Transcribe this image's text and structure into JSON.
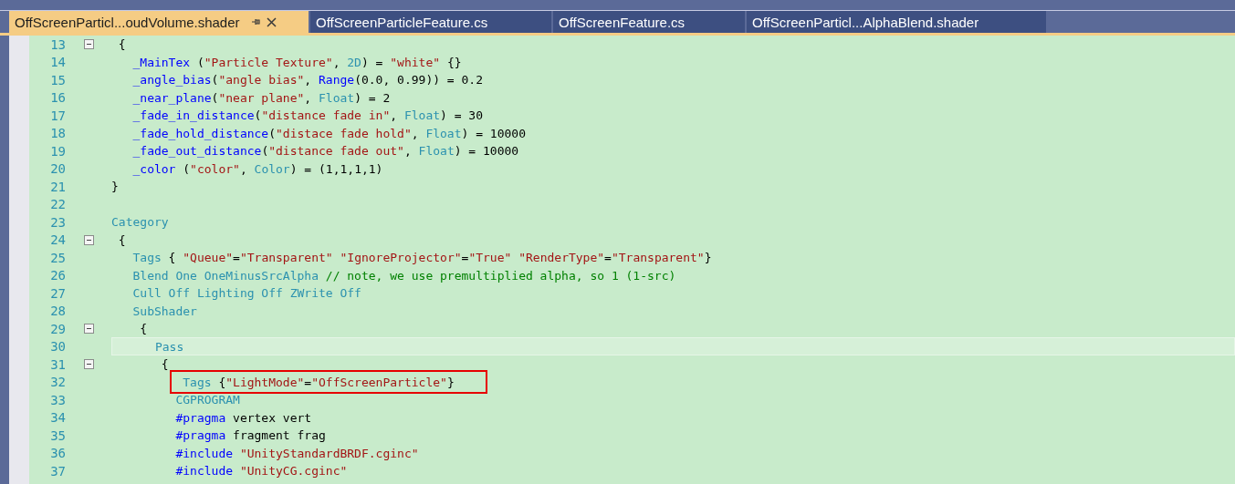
{
  "tabs": [
    {
      "label": "OffScreenParticl...oudVolume.shader",
      "selected": true,
      "pinned": true
    },
    {
      "label": "OffScreenParticleFeature.cs",
      "selected": false,
      "pinned": false
    },
    {
      "label": "OffScreenFeature.cs",
      "selected": false,
      "pinned": false
    },
    {
      "label": "OffScreenParticl...AlphaBlend.shader",
      "selected": false,
      "pinned": false
    }
  ],
  "lines": [
    {
      "number": "13",
      "fold": true,
      "tokens": [
        {
          "t": " {",
          "kind": "plain"
        }
      ]
    },
    {
      "number": "14",
      "tokens": [
        {
          "t": "   _MainTex",
          "kind": "ident"
        },
        {
          "t": " (",
          "kind": "plain"
        },
        {
          "t": "\"Particle Texture\"",
          "kind": "string"
        },
        {
          "t": ", ",
          "kind": "plain"
        },
        {
          "t": "2D",
          "kind": "type"
        },
        {
          "t": ") = ",
          "kind": "plain"
        },
        {
          "t": "\"white\"",
          "kind": "string"
        },
        {
          "t": " {}",
          "kind": "plain"
        }
      ]
    },
    {
      "number": "15",
      "tokens": [
        {
          "t": "   _angle_bias",
          "kind": "ident"
        },
        {
          "t": "(",
          "kind": "plain"
        },
        {
          "t": "\"angle bias\"",
          "kind": "string"
        },
        {
          "t": ", ",
          "kind": "plain"
        },
        {
          "t": "Range",
          "kind": "ident"
        },
        {
          "t": "(0.0, 0.99)) = 0.2",
          "kind": "plain"
        }
      ]
    },
    {
      "number": "16",
      "tokens": [
        {
          "t": "   _near_plane",
          "kind": "ident"
        },
        {
          "t": "(",
          "kind": "plain"
        },
        {
          "t": "\"near plane\"",
          "kind": "string"
        },
        {
          "t": ", ",
          "kind": "plain"
        },
        {
          "t": "Float",
          "kind": "type"
        },
        {
          "t": ") = 2",
          "kind": "plain"
        }
      ]
    },
    {
      "number": "17",
      "tokens": [
        {
          "t": "   _fade_in_distance",
          "kind": "ident"
        },
        {
          "t": "(",
          "kind": "plain"
        },
        {
          "t": "\"distance fade in\"",
          "kind": "string"
        },
        {
          "t": ", ",
          "kind": "plain"
        },
        {
          "t": "Float",
          "kind": "type"
        },
        {
          "t": ") = 30",
          "kind": "plain"
        }
      ]
    },
    {
      "number": "18",
      "tokens": [
        {
          "t": "   _fade_hold_distance",
          "kind": "ident"
        },
        {
          "t": "(",
          "kind": "plain"
        },
        {
          "t": "\"distace fade hold\"",
          "kind": "string"
        },
        {
          "t": ", ",
          "kind": "plain"
        },
        {
          "t": "Float",
          "kind": "type"
        },
        {
          "t": ") = 10000",
          "kind": "plain"
        }
      ]
    },
    {
      "number": "19",
      "tokens": [
        {
          "t": "   _fade_out_distance",
          "kind": "ident"
        },
        {
          "t": "(",
          "kind": "plain"
        },
        {
          "t": "\"distance fade out\"",
          "kind": "string"
        },
        {
          "t": ", ",
          "kind": "plain"
        },
        {
          "t": "Float",
          "kind": "type"
        },
        {
          "t": ") = 10000",
          "kind": "plain"
        }
      ]
    },
    {
      "number": "20",
      "tokens": [
        {
          "t": "   _color",
          "kind": "ident"
        },
        {
          "t": " (",
          "kind": "plain"
        },
        {
          "t": "\"color\"",
          "kind": "string"
        },
        {
          "t": ", ",
          "kind": "plain"
        },
        {
          "t": "Color",
          "kind": "type"
        },
        {
          "t": ") = (1,1,1,1)",
          "kind": "plain"
        }
      ]
    },
    {
      "number": "21",
      "tokens": [
        {
          "t": "}",
          "kind": "plain"
        }
      ]
    },
    {
      "number": "22"
    },
    {
      "number": "23",
      "tokens": [
        {
          "t": "Category",
          "kind": "type"
        }
      ]
    },
    {
      "number": "24",
      "fold": true,
      "tokens": [
        {
          "t": " {",
          "kind": "plain"
        }
      ]
    },
    {
      "number": "25",
      "tokens": [
        {
          "t": "   Tags",
          "kind": "type"
        },
        {
          "t": " { ",
          "kind": "plain"
        },
        {
          "t": "\"Queue\"",
          "kind": "string"
        },
        {
          "t": "=",
          "kind": "plain"
        },
        {
          "t": "\"Transparent\" ",
          "kind": "string"
        },
        {
          "t": "\"IgnoreProjector\"",
          "kind": "string"
        },
        {
          "t": "=",
          "kind": "plain"
        },
        {
          "t": "\"True\" ",
          "kind": "string"
        },
        {
          "t": "\"RenderType\"",
          "kind": "string"
        },
        {
          "t": "=",
          "kind": "plain"
        },
        {
          "t": "\"Transparent\"",
          "kind": "string"
        },
        {
          "t": "}",
          "kind": "plain"
        }
      ]
    },
    {
      "number": "26",
      "tokens": [
        {
          "t": "   Blend One OneMinusSrcAlpha",
          "kind": "type"
        },
        {
          "t": " // note, we use premultiplied alpha, so 1 (1-src)",
          "kind": "comment"
        }
      ]
    },
    {
      "number": "27",
      "tokens": [
        {
          "t": "   Cull Off Lighting Off ZWrite Off",
          "kind": "type"
        }
      ]
    },
    {
      "number": "28",
      "tokens": [
        {
          "t": "   SubShader",
          "kind": "type"
        }
      ]
    },
    {
      "number": "29",
      "fold": true,
      "tokens": [
        {
          "t": "    {",
          "kind": "plain"
        }
      ]
    },
    {
      "number": "30",
      "current": true,
      "tokens": [
        {
          "t": "      Pass",
          "kind": "type"
        }
      ]
    },
    {
      "number": "31",
      "fold": true,
      "tokens": [
        {
          "t": "       {",
          "kind": "plain"
        }
      ]
    },
    {
      "number": "32",
      "annotated": true,
      "tokens": [
        {
          "t": "          Tags",
          "kind": "type"
        },
        {
          "t": " {",
          "kind": "plain"
        },
        {
          "t": "\"LightMode\"",
          "kind": "string"
        },
        {
          "t": "=",
          "kind": "plain"
        },
        {
          "t": "\"OffScreenParticle\"",
          "kind": "string"
        },
        {
          "t": "}",
          "kind": "plain"
        }
      ]
    },
    {
      "number": "33",
      "tokens": [
        {
          "t": "         CGPROGRAM",
          "kind": "type"
        }
      ]
    },
    {
      "number": "34",
      "tokens": [
        {
          "t": "         #pragma",
          "kind": "ident"
        },
        {
          "t": " vertex vert",
          "kind": "plain"
        }
      ]
    },
    {
      "number": "35",
      "tokens": [
        {
          "t": "         #pragma",
          "kind": "ident"
        },
        {
          "t": " fragment frag",
          "kind": "plain"
        }
      ]
    },
    {
      "number": "36",
      "tokens": [
        {
          "t": "         #include",
          "kind": "ident"
        },
        {
          "t": " \"UnityStandardBRDF.cginc\"",
          "kind": "string"
        }
      ]
    },
    {
      "number": "37",
      "tokens": [
        {
          "t": "         #include",
          "kind": "ident"
        },
        {
          "t": " \"UnityCG.cginc\"",
          "kind": "string"
        }
      ]
    }
  ]
}
